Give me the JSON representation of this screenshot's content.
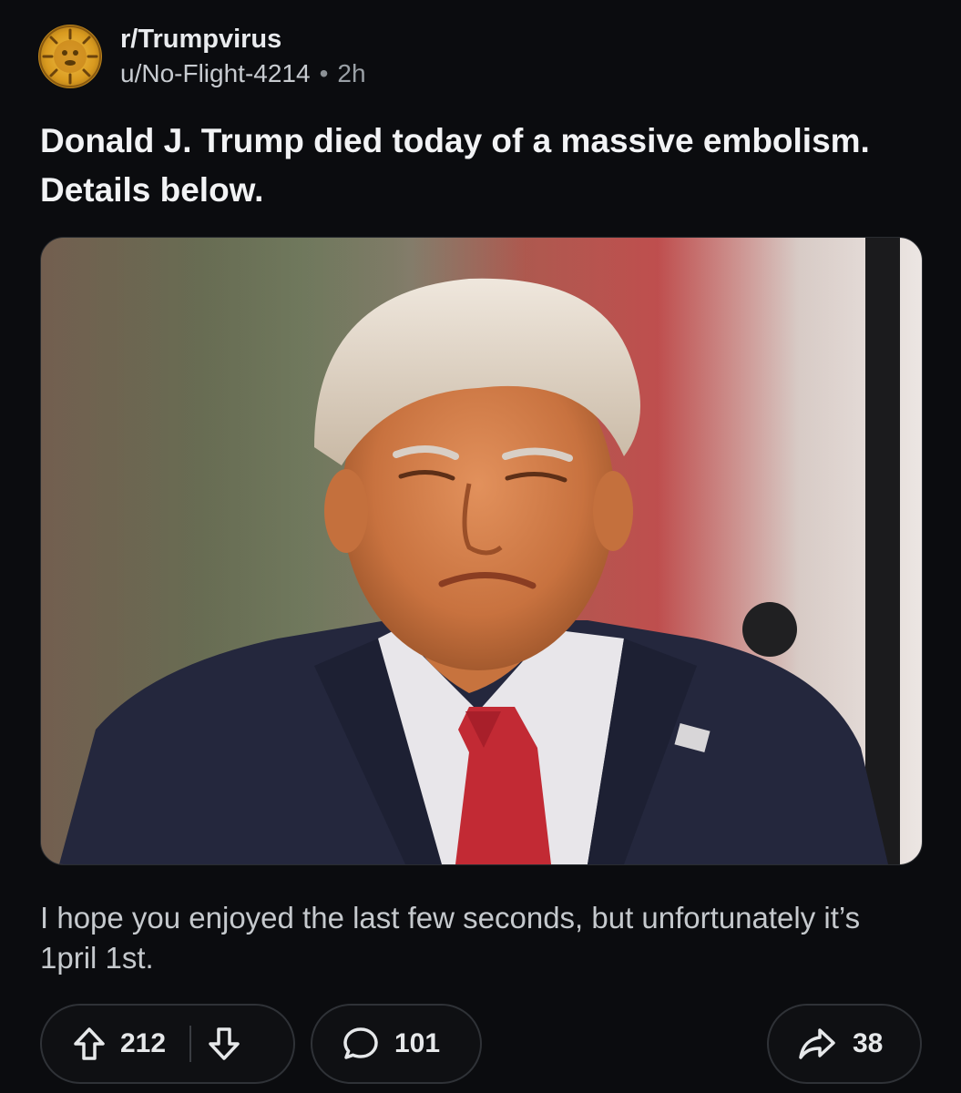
{
  "post": {
    "subreddit": "r/Trumpvirus",
    "author": "u/No-Flight-4214",
    "separator": "•",
    "age": "2h",
    "title": "Donald J. Trump died today of a massive embolism. Details below.",
    "body": "I hope you enjoyed the last few seconds, but unfortunately it’s 1pril 1st."
  },
  "actions": {
    "upvotes": "212",
    "comments": "101",
    "shares": "38"
  },
  "icons": {
    "avatar": "subreddit-avatar-icon",
    "upvote": "upvote-arrow-icon",
    "downvote": "downvote-arrow-icon",
    "comment": "comment-bubble-icon",
    "share": "share-arrow-icon"
  }
}
